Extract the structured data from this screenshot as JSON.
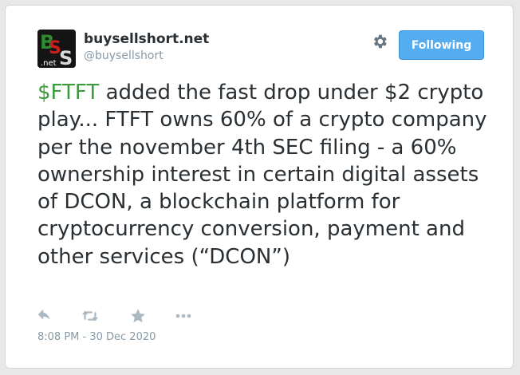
{
  "tweet": {
    "author": {
      "display_name": "buysellshort.net",
      "handle": "@buysellshort",
      "avatar": {
        "text": "BSS",
        "subtext": ".net",
        "icon": "buysellshort-logo"
      }
    },
    "follow_button": {
      "label": "Following",
      "color": "#55acee"
    },
    "settings_icon": "gear-icon",
    "text": {
      "cashtag": "$FTFT",
      "body": " added the fast drop under $2 crypto play... FTFT owns 60% of a crypto company per the november 4th SEC filing - a 60% ownership interest in certain digital assets of DCON, a blockchain platform for cryptocurrency conversion, payment and other services (“DCON”)"
    },
    "actions": [
      "reply-icon",
      "retweet-icon",
      "favorite-icon",
      "more-icon"
    ],
    "timestamp": "8:08 PM - 30 Dec 2020"
  },
  "colors": {
    "cashtag": "#3a9b3a",
    "text": "#292f33",
    "muted": "#8899a6"
  }
}
